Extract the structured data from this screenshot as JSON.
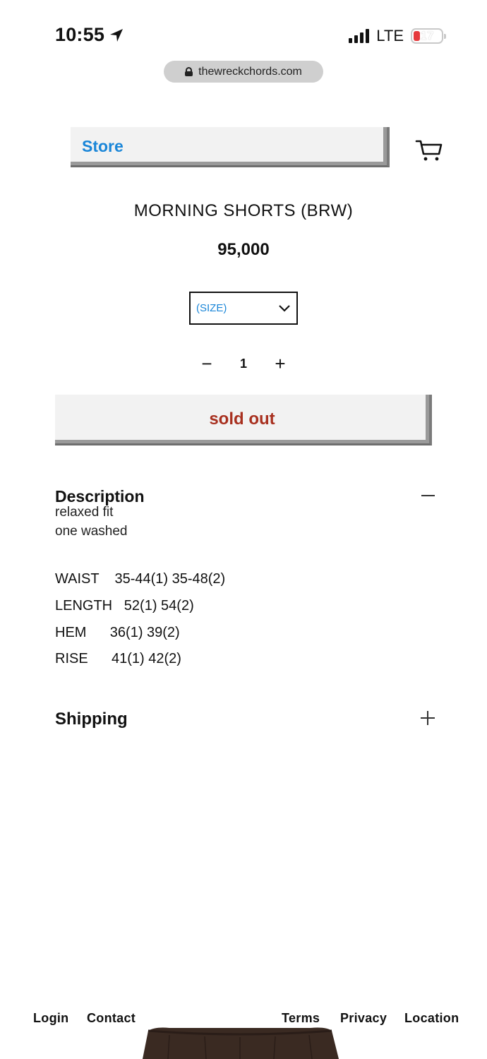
{
  "status_bar": {
    "time": "10:55",
    "network": "LTE",
    "battery": "17",
    "colors": {
      "battery_low": "#e5383b"
    }
  },
  "browser": {
    "url": "thewreckchords.com"
  },
  "nav": {
    "store_label": "Store",
    "cart_icon": "cart-icon",
    "colors": {
      "link": "#1a86d8"
    }
  },
  "product": {
    "title": "MORNING SHORTS (BRW)",
    "price": "95,000",
    "size_select": {
      "selected": "(SIZE)"
    },
    "quantity": {
      "decrement": "−",
      "value": "1",
      "increment": "+"
    },
    "sold_out_label": "sold out",
    "colors": {
      "sold_out": "#a8301f"
    }
  },
  "description": {
    "heading": "Description",
    "lines": [
      "relaxed fit",
      "one washed"
    ],
    "specs": [
      "WAIST    35-44(1) 35-48(2)",
      "LENGTH   52(1) 54(2)",
      "HEM      36(1) 39(2)",
      "RISE      41(1) 42(2)"
    ]
  },
  "shipping": {
    "heading": "Shipping"
  },
  "footer": {
    "login": "Login",
    "contact": "Contact",
    "terms": "Terms",
    "privacy": "Privacy",
    "location": "Location"
  }
}
